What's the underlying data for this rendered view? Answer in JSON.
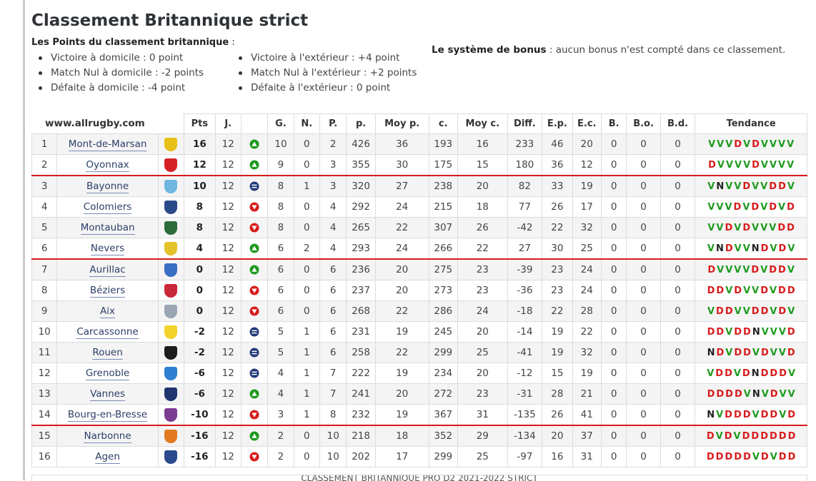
{
  "title": "Classement Britannique strict",
  "points_label": {
    "bold": "Les Points du classement britannique",
    "suffix": " :"
  },
  "home_points": [
    "Victoire à domicile : 0 point",
    "Match Nul à domicile : -2 points",
    "Défaite à domicile : -4 point"
  ],
  "away_points": [
    "Victoire à l'extérieur : +4 point",
    "Match Nul à l'extérieur : +2 points",
    "Défaite à l'extérieur : 0 point"
  ],
  "bonus": {
    "bold": "Le système de bonus",
    "text": " : aucun bonus n'est compté dans ce classement."
  },
  "table": {
    "site": "www.allrugby.com",
    "headers": {
      "pts": "Pts",
      "j": "J.",
      "g": "G.",
      "n": "N.",
      "p": "P.",
      "pp": "p.",
      "moyp": "Moy p.",
      "c": "c.",
      "moyc": "Moy c.",
      "diff": "Diff.",
      "ep": "E.p.",
      "ec": "E.c.",
      "b": "B.",
      "bo": "B.o.",
      "bd": "B.d.",
      "tendance": "Tendance"
    },
    "colors": {
      "up": "#1f9a1f",
      "down": "#d81b1b",
      "same": "#223a7a",
      "zone_line": "#d81b1b"
    },
    "rows": [
      {
        "rank": "1",
        "team": "Mont-de-Marsan",
        "logo": "#e8c018",
        "pts": "16",
        "j": "12",
        "move": "up",
        "g": "10",
        "n": "0",
        "p": "2",
        "pp": "426",
        "moyp": "36",
        "c": "193",
        "moyc": "16",
        "diff": "233",
        "ep": "46",
        "ec": "20",
        "b": "0",
        "bo": "0",
        "bd": "0",
        "trend": "VVVDVDVVVV"
      },
      {
        "rank": "2",
        "team": "Oyonnax",
        "logo": "#d62027",
        "pts": "12",
        "j": "12",
        "move": "up",
        "g": "9",
        "n": "0",
        "p": "3",
        "pp": "355",
        "moyp": "30",
        "c": "175",
        "moyc": "15",
        "diff": "180",
        "ep": "36",
        "ec": "12",
        "b": "0",
        "bo": "0",
        "bd": "0",
        "trend": "DVVVVDVVVV"
      },
      {
        "rank": "3",
        "team": "Bayonne",
        "logo": "#6fb7e0",
        "pts": "10",
        "j": "12",
        "move": "same",
        "g": "8",
        "n": "1",
        "p": "3",
        "pp": "320",
        "moyp": "27",
        "c": "238",
        "moyc": "20",
        "diff": "82",
        "ep": "33",
        "ec": "19",
        "b": "0",
        "bo": "0",
        "bd": "0",
        "trend": "VNVVDVVDDV"
      },
      {
        "rank": "4",
        "team": "Colomiers",
        "logo": "#2a4a8a",
        "pts": "8",
        "j": "12",
        "move": "down",
        "g": "8",
        "n": "0",
        "p": "4",
        "pp": "292",
        "moyp": "24",
        "c": "215",
        "moyc": "18",
        "diff": "77",
        "ep": "26",
        "ec": "17",
        "b": "0",
        "bo": "0",
        "bd": "0",
        "trend": "VVVDVDVDVD"
      },
      {
        "rank": "5",
        "team": "Montauban",
        "logo": "#2d6b3a",
        "pts": "8",
        "j": "12",
        "move": "down",
        "g": "8",
        "n": "0",
        "p": "4",
        "pp": "265",
        "moyp": "22",
        "c": "307",
        "moyc": "26",
        "diff": "-42",
        "ep": "22",
        "ec": "32",
        "b": "0",
        "bo": "0",
        "bd": "0",
        "trend": "VVDVDVVVDD"
      },
      {
        "rank": "6",
        "team": "Nevers",
        "logo": "#e3c22a",
        "pts": "4",
        "j": "12",
        "move": "up",
        "g": "6",
        "n": "2",
        "p": "4",
        "pp": "293",
        "moyp": "24",
        "c": "266",
        "moyc": "22",
        "diff": "27",
        "ep": "30",
        "ec": "25",
        "b": "0",
        "bo": "0",
        "bd": "0",
        "trend": "VNDVVNDVDV"
      },
      {
        "rank": "7",
        "team": "Aurillac",
        "logo": "#3b6fc4",
        "pts": "0",
        "j": "12",
        "move": "up",
        "g": "6",
        "n": "0",
        "p": "6",
        "pp": "236",
        "moyp": "20",
        "c": "275",
        "moyc": "23",
        "diff": "-39",
        "ep": "23",
        "ec": "24",
        "b": "0",
        "bo": "0",
        "bd": "0",
        "trend": "DVVVVDVDDV"
      },
      {
        "rank": "8",
        "team": "Béziers",
        "logo": "#c8283a",
        "pts": "0",
        "j": "12",
        "move": "down",
        "g": "6",
        "n": "0",
        "p": "6",
        "pp": "237",
        "moyp": "20",
        "c": "273",
        "moyc": "23",
        "diff": "-36",
        "ep": "23",
        "ec": "24",
        "b": "0",
        "bo": "0",
        "bd": "0",
        "trend": "DDVDVVDVDD"
      },
      {
        "rank": "9",
        "team": "Aix",
        "logo": "#9aa6b4",
        "pts": "0",
        "j": "12",
        "move": "down",
        "g": "6",
        "n": "0",
        "p": "6",
        "pp": "268",
        "moyp": "22",
        "c": "286",
        "moyc": "24",
        "diff": "-18",
        "ep": "22",
        "ec": "28",
        "b": "0",
        "bo": "0",
        "bd": "0",
        "trend": "VDDVVDDVDV"
      },
      {
        "rank": "10",
        "team": "Carcassonne",
        "logo": "#f2d22b",
        "pts": "-2",
        "j": "12",
        "move": "same",
        "g": "5",
        "n": "1",
        "p": "6",
        "pp": "231",
        "moyp": "19",
        "c": "245",
        "moyc": "20",
        "diff": "-14",
        "ep": "19",
        "ec": "22",
        "b": "0",
        "bo": "0",
        "bd": "0",
        "trend": "DDVDDNVVVD"
      },
      {
        "rank": "11",
        "team": "Rouen",
        "logo": "#1d1d1d",
        "pts": "-2",
        "j": "12",
        "move": "same",
        "g": "5",
        "n": "1",
        "p": "6",
        "pp": "258",
        "moyp": "22",
        "c": "299",
        "moyc": "25",
        "diff": "-41",
        "ep": "19",
        "ec": "32",
        "b": "0",
        "bo": "0",
        "bd": "0",
        "trend": "NDVDDVDVVD"
      },
      {
        "rank": "12",
        "team": "Grenoble",
        "logo": "#2d7fd1",
        "pts": "-6",
        "j": "12",
        "move": "same",
        "g": "4",
        "n": "1",
        "p": "7",
        "pp": "222",
        "moyp": "19",
        "c": "234",
        "moyc": "20",
        "diff": "-12",
        "ep": "15",
        "ec": "19",
        "b": "0",
        "bo": "0",
        "bd": "0",
        "trend": "VDDVDNDDDV"
      },
      {
        "rank": "13",
        "team": "Vannes",
        "logo": "#1e3570",
        "pts": "-6",
        "j": "12",
        "move": "up",
        "g": "4",
        "n": "1",
        "p": "7",
        "pp": "241",
        "moyp": "20",
        "c": "272",
        "moyc": "23",
        "diff": "-31",
        "ep": "28",
        "ec": "21",
        "b": "0",
        "bo": "0",
        "bd": "0",
        "trend": "DDDDVNVDVV"
      },
      {
        "rank": "14",
        "team": "Bourg-en-Bresse",
        "logo": "#7b3d92",
        "pts": "-10",
        "j": "12",
        "move": "down",
        "g": "3",
        "n": "1",
        "p": "8",
        "pp": "232",
        "moyp": "19",
        "c": "367",
        "moyc": "31",
        "diff": "-135",
        "ep": "26",
        "ec": "41",
        "b": "0",
        "bo": "0",
        "bd": "0",
        "trend": "NVDDDVDDVD"
      },
      {
        "rank": "15",
        "team": "Narbonne",
        "logo": "#e37a22",
        "pts": "-16",
        "j": "12",
        "move": "up",
        "g": "2",
        "n": "0",
        "p": "10",
        "pp": "218",
        "moyp": "18",
        "c": "352",
        "moyc": "29",
        "diff": "-134",
        "ep": "20",
        "ec": "37",
        "b": "0",
        "bo": "0",
        "bd": "0",
        "trend": "DVDVDDDDDD"
      },
      {
        "rank": "16",
        "team": "Agen",
        "logo": "#2b4a8e",
        "pts": "-16",
        "j": "12",
        "move": "down",
        "g": "2",
        "n": "0",
        "p": "10",
        "pp": "202",
        "moyp": "17",
        "c": "299",
        "moyc": "25",
        "diff": "-97",
        "ep": "16",
        "ec": "31",
        "b": "0",
        "bo": "0",
        "bd": "0",
        "trend": "DDDDDVDVDD"
      }
    ]
  },
  "caption": "CLASSEMENT BRITANNIQUE PRO D2 2021-2022 STRICT"
}
